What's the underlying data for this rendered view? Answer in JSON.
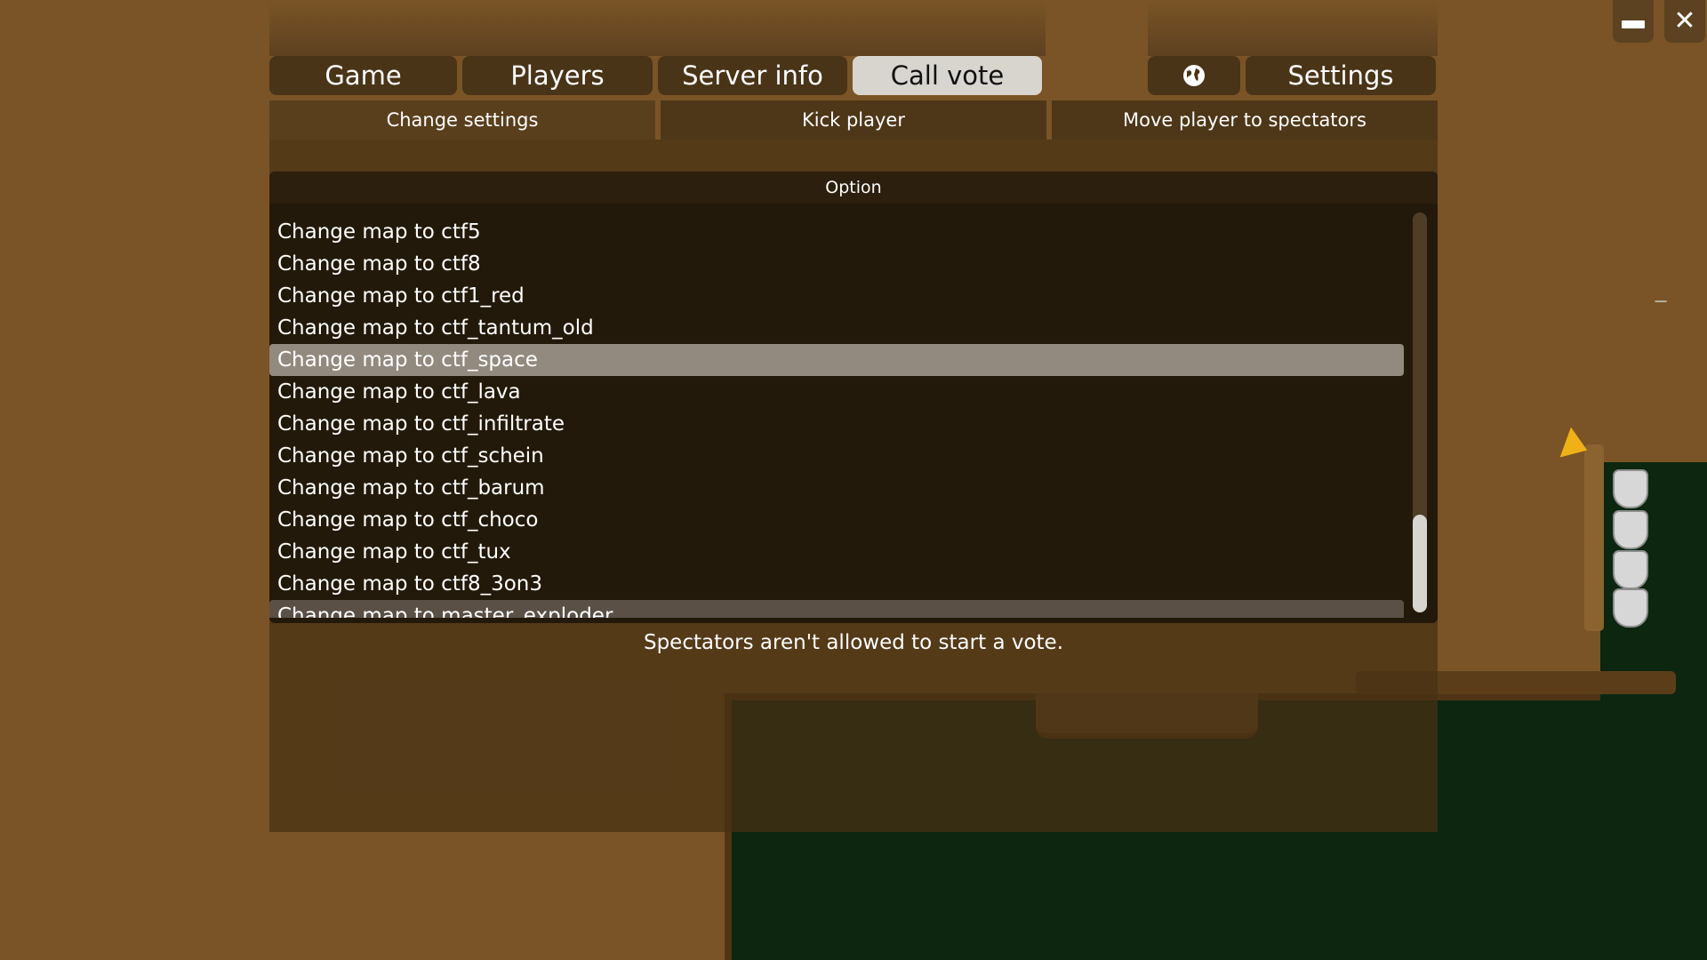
{
  "window_controls": {
    "minimize_icon": "minimize-icon",
    "close_label": "✕"
  },
  "main_tabs": [
    {
      "label": "Game",
      "active": false
    },
    {
      "label": "Players",
      "active": false
    },
    {
      "label": "Server info",
      "active": false
    },
    {
      "label": "Call vote",
      "active": true
    }
  ],
  "right_tabs": {
    "globe_icon": "globe-icon",
    "settings_label": "Settings"
  },
  "vote_tabs": [
    {
      "label": "Change settings",
      "active": true
    },
    {
      "label": "Kick player",
      "active": false
    },
    {
      "label": "Move player to spectators",
      "active": false
    }
  ],
  "option_list": {
    "header": "Option",
    "items": [
      "Change map to ctf5",
      "Change map to ctf8",
      "Change map to ctf1_red",
      "Change map to ctf_tantum_old",
      "Change map to ctf_space",
      "Change map to ctf_lava",
      "Change map to ctf_infiltrate",
      "Change map to ctf_schein",
      "Change map to ctf_barum",
      "Change map to ctf_choco",
      "Change map to ctf_tux",
      "Change map to ctf8_3on3",
      "Change map to master_exploder"
    ],
    "selected": "Change map to ctf_space",
    "hovered": "Change map to master_exploder"
  },
  "status_message": "Spectators aren't allowed to start a vote.",
  "colors": {
    "background_dirt": "#7a5426",
    "tab_active": "#d8d5cf",
    "row_selected": "#938a7f",
    "cursor": "#f0b018"
  }
}
